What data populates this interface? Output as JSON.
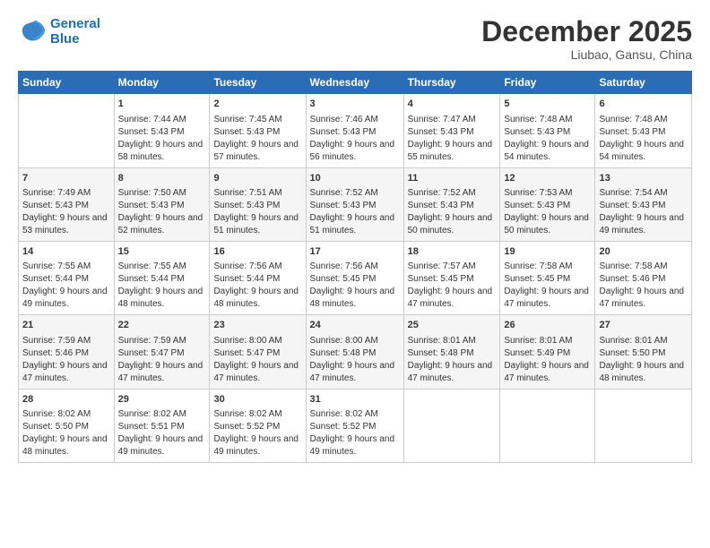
{
  "logo": {
    "line1": "General",
    "line2": "Blue"
  },
  "title": "December 2025",
  "location": "Liubao, Gansu, China",
  "headers": [
    "Sunday",
    "Monday",
    "Tuesday",
    "Wednesday",
    "Thursday",
    "Friday",
    "Saturday"
  ],
  "weeks": [
    [
      {
        "day": "",
        "sunrise": "",
        "sunset": "",
        "daylight": ""
      },
      {
        "day": "1",
        "sunrise": "Sunrise: 7:44 AM",
        "sunset": "Sunset: 5:43 PM",
        "daylight": "Daylight: 9 hours and 58 minutes."
      },
      {
        "day": "2",
        "sunrise": "Sunrise: 7:45 AM",
        "sunset": "Sunset: 5:43 PM",
        "daylight": "Daylight: 9 hours and 57 minutes."
      },
      {
        "day": "3",
        "sunrise": "Sunrise: 7:46 AM",
        "sunset": "Sunset: 5:43 PM",
        "daylight": "Daylight: 9 hours and 56 minutes."
      },
      {
        "day": "4",
        "sunrise": "Sunrise: 7:47 AM",
        "sunset": "Sunset: 5:43 PM",
        "daylight": "Daylight: 9 hours and 55 minutes."
      },
      {
        "day": "5",
        "sunrise": "Sunrise: 7:48 AM",
        "sunset": "Sunset: 5:43 PM",
        "daylight": "Daylight: 9 hours and 54 minutes."
      },
      {
        "day": "6",
        "sunrise": "Sunrise: 7:48 AM",
        "sunset": "Sunset: 5:43 PM",
        "daylight": "Daylight: 9 hours and 54 minutes."
      }
    ],
    [
      {
        "day": "7",
        "sunrise": "Sunrise: 7:49 AM",
        "sunset": "Sunset: 5:43 PM",
        "daylight": "Daylight: 9 hours and 53 minutes."
      },
      {
        "day": "8",
        "sunrise": "Sunrise: 7:50 AM",
        "sunset": "Sunset: 5:43 PM",
        "daylight": "Daylight: 9 hours and 52 minutes."
      },
      {
        "day": "9",
        "sunrise": "Sunrise: 7:51 AM",
        "sunset": "Sunset: 5:43 PM",
        "daylight": "Daylight: 9 hours and 51 minutes."
      },
      {
        "day": "10",
        "sunrise": "Sunrise: 7:52 AM",
        "sunset": "Sunset: 5:43 PM",
        "daylight": "Daylight: 9 hours and 51 minutes."
      },
      {
        "day": "11",
        "sunrise": "Sunrise: 7:52 AM",
        "sunset": "Sunset: 5:43 PM",
        "daylight": "Daylight: 9 hours and 50 minutes."
      },
      {
        "day": "12",
        "sunrise": "Sunrise: 7:53 AM",
        "sunset": "Sunset: 5:43 PM",
        "daylight": "Daylight: 9 hours and 50 minutes."
      },
      {
        "day": "13",
        "sunrise": "Sunrise: 7:54 AM",
        "sunset": "Sunset: 5:43 PM",
        "daylight": "Daylight: 9 hours and 49 minutes."
      }
    ],
    [
      {
        "day": "14",
        "sunrise": "Sunrise: 7:55 AM",
        "sunset": "Sunset: 5:44 PM",
        "daylight": "Daylight: 9 hours and 49 minutes."
      },
      {
        "day": "15",
        "sunrise": "Sunrise: 7:55 AM",
        "sunset": "Sunset: 5:44 PM",
        "daylight": "Daylight: 9 hours and 48 minutes."
      },
      {
        "day": "16",
        "sunrise": "Sunrise: 7:56 AM",
        "sunset": "Sunset: 5:44 PM",
        "daylight": "Daylight: 9 hours and 48 minutes."
      },
      {
        "day": "17",
        "sunrise": "Sunrise: 7:56 AM",
        "sunset": "Sunset: 5:45 PM",
        "daylight": "Daylight: 9 hours and 48 minutes."
      },
      {
        "day": "18",
        "sunrise": "Sunrise: 7:57 AM",
        "sunset": "Sunset: 5:45 PM",
        "daylight": "Daylight: 9 hours and 47 minutes."
      },
      {
        "day": "19",
        "sunrise": "Sunrise: 7:58 AM",
        "sunset": "Sunset: 5:45 PM",
        "daylight": "Daylight: 9 hours and 47 minutes."
      },
      {
        "day": "20",
        "sunrise": "Sunrise: 7:58 AM",
        "sunset": "Sunset: 5:46 PM",
        "daylight": "Daylight: 9 hours and 47 minutes."
      }
    ],
    [
      {
        "day": "21",
        "sunrise": "Sunrise: 7:59 AM",
        "sunset": "Sunset: 5:46 PM",
        "daylight": "Daylight: 9 hours and 47 minutes."
      },
      {
        "day": "22",
        "sunrise": "Sunrise: 7:59 AM",
        "sunset": "Sunset: 5:47 PM",
        "daylight": "Daylight: 9 hours and 47 minutes."
      },
      {
        "day": "23",
        "sunrise": "Sunrise: 8:00 AM",
        "sunset": "Sunset: 5:47 PM",
        "daylight": "Daylight: 9 hours and 47 minutes."
      },
      {
        "day": "24",
        "sunrise": "Sunrise: 8:00 AM",
        "sunset": "Sunset: 5:48 PM",
        "daylight": "Daylight: 9 hours and 47 minutes."
      },
      {
        "day": "25",
        "sunrise": "Sunrise: 8:01 AM",
        "sunset": "Sunset: 5:48 PM",
        "daylight": "Daylight: 9 hours and 47 minutes."
      },
      {
        "day": "26",
        "sunrise": "Sunrise: 8:01 AM",
        "sunset": "Sunset: 5:49 PM",
        "daylight": "Daylight: 9 hours and 47 minutes."
      },
      {
        "day": "27",
        "sunrise": "Sunrise: 8:01 AM",
        "sunset": "Sunset: 5:50 PM",
        "daylight": "Daylight: 9 hours and 48 minutes."
      }
    ],
    [
      {
        "day": "28",
        "sunrise": "Sunrise: 8:02 AM",
        "sunset": "Sunset: 5:50 PM",
        "daylight": "Daylight: 9 hours and 48 minutes."
      },
      {
        "day": "29",
        "sunrise": "Sunrise: 8:02 AM",
        "sunset": "Sunset: 5:51 PM",
        "daylight": "Daylight: 9 hours and 49 minutes."
      },
      {
        "day": "30",
        "sunrise": "Sunrise: 8:02 AM",
        "sunset": "Sunset: 5:52 PM",
        "daylight": "Daylight: 9 hours and 49 minutes."
      },
      {
        "day": "31",
        "sunrise": "Sunrise: 8:02 AM",
        "sunset": "Sunset: 5:52 PM",
        "daylight": "Daylight: 9 hours and 49 minutes."
      },
      {
        "day": "",
        "sunrise": "",
        "sunset": "",
        "daylight": ""
      },
      {
        "day": "",
        "sunrise": "",
        "sunset": "",
        "daylight": ""
      },
      {
        "day": "",
        "sunrise": "",
        "sunset": "",
        "daylight": ""
      }
    ]
  ]
}
